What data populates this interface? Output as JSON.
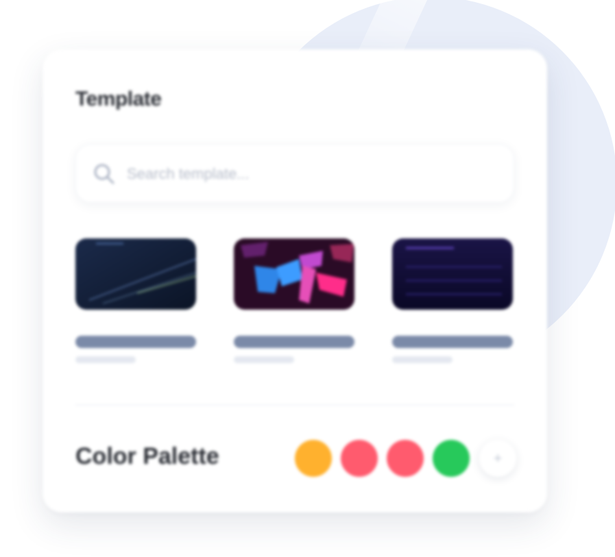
{
  "panel": {
    "title": "Template"
  },
  "search": {
    "placeholder": "Search template...",
    "icon": "search-icon"
  },
  "templates": [
    {
      "name": "",
      "meta": "",
      "thumb": "dark-navy-lines"
    },
    {
      "name": "",
      "meta": "",
      "thumb": "neon-pink-blue"
    },
    {
      "name": "",
      "meta": "",
      "thumb": "purple-night"
    }
  ],
  "palette": {
    "label": "Color Palette",
    "colors": [
      "#FFB12E",
      "#FF5B6E",
      "#FF5B6E",
      "#27C95B"
    ],
    "add_label": "+"
  }
}
